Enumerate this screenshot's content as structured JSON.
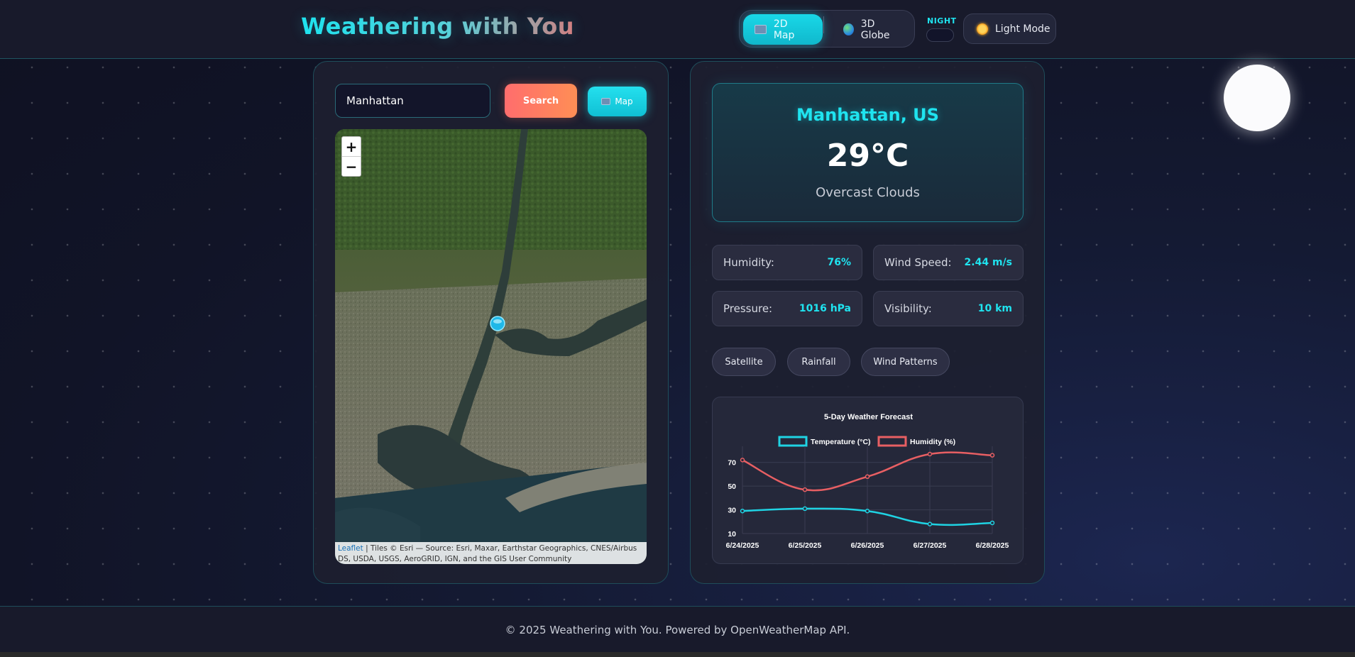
{
  "header": {
    "brand": "Weathering with You",
    "view_toggle": {
      "map2d_label": "2D Map",
      "globe3d_label": "3D Globe"
    },
    "night_label": "NIGHT",
    "light_mode_label": "Light Mode"
  },
  "search": {
    "value": "Manhattan",
    "search_label": "Search",
    "map_label": "Map"
  },
  "map": {
    "zoom_in": "+",
    "zoom_out": "−",
    "attribution_leaflet": "Leaflet",
    "attribution_text": " | Tiles © Esri — Source: Esri, Maxar, Earthstar Geographics, CNES/Airbus DS, USDA, USGS, AeroGRID, IGN, and the GIS User Community"
  },
  "weather": {
    "city": "Manhattan, US",
    "temperature": "29°C",
    "description": "Overcast Clouds"
  },
  "stats": {
    "humidity_label": "Humidity:",
    "humidity_value": "76%",
    "wind_label": "Wind Speed:",
    "wind_value": "2.44 m/s",
    "pressure_label": "Pressure:",
    "pressure_value": "1016 hPa",
    "visibility_label": "Visibility:",
    "visibility_value": "10 km"
  },
  "layers": {
    "satellite": "Satellite",
    "rainfall": "Rainfall",
    "wind": "Wind Patterns"
  },
  "chart_data": {
    "type": "line",
    "title": "5-Day Weather Forecast",
    "categories": [
      "6/24/2025",
      "6/25/2025",
      "6/26/2025",
      "6/27/2025",
      "6/28/2025"
    ],
    "series": [
      {
        "name": "Temperature (°C)",
        "values": [
          29,
          31,
          29,
          18,
          19
        ],
        "color": "#1fd3e3"
      },
      {
        "name": "Humidity (%)",
        "values": [
          72,
          47,
          58,
          77,
          76
        ],
        "color": "#e85f63"
      }
    ],
    "ylim": [
      10,
      80
    ],
    "yticks": [
      10,
      30,
      50,
      70
    ],
    "legend": "top",
    "grid": true
  },
  "footer": {
    "text": "© 2025 Weathering with You. Powered by OpenWeatherMap API."
  },
  "colors": {
    "accent": "#1fe3ef",
    "search": "#ff7a62",
    "background": "#141a33"
  }
}
